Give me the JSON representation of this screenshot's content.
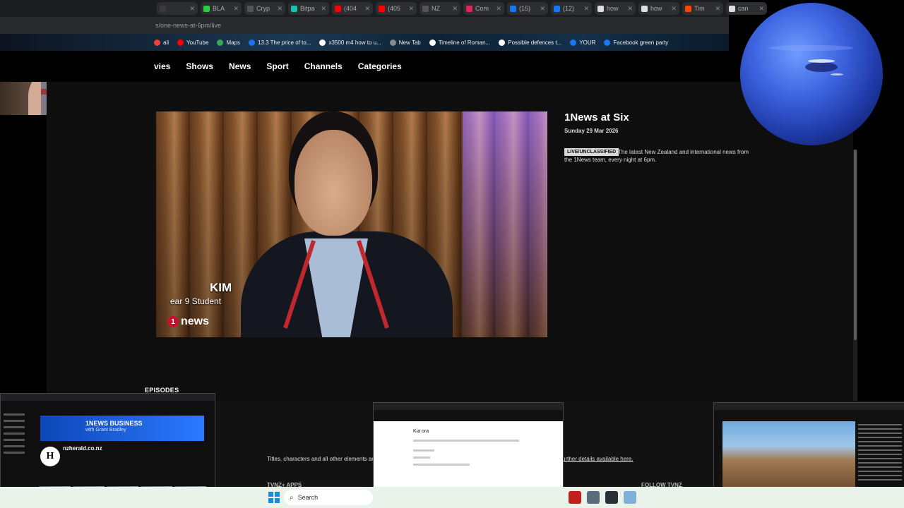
{
  "browser": {
    "tabs": [
      {
        "label": "",
        "color": "#3b3b3b"
      },
      {
        "label": "BLA",
        "color": "#2ecc40"
      },
      {
        "label": "Cryp",
        "color": "#555555"
      },
      {
        "label": "Bitpa",
        "color": "#19c1b0"
      },
      {
        "label": "(404",
        "color": "#ff0000"
      },
      {
        "label": "(405",
        "color": "#ff0000"
      },
      {
        "label": "NZ",
        "color": "#555555"
      },
      {
        "label": "Com",
        "color": "#e0245e"
      },
      {
        "label": "(15)",
        "color": "#1877f2"
      },
      {
        "label": "(12)",
        "color": "#1877f2"
      },
      {
        "label": "how",
        "color": "#dddddd"
      },
      {
        "label": "how",
        "color": "#dddddd"
      },
      {
        "label": "Tim",
        "color": "#ff4500"
      },
      {
        "label": "can",
        "color": "#dddddd"
      }
    ],
    "url": "s/one-news-at-6pm/live",
    "bookmarks": [
      {
        "label": "ail",
        "color": "#ea4335"
      },
      {
        "label": "YouTube",
        "color": "#ff0000"
      },
      {
        "label": "Maps",
        "color": "#34a853"
      },
      {
        "label": "13.3 The price of to...",
        "color": "#1a73e8"
      },
      {
        "label": "x3500 m4 how to u...",
        "color": "#ffffff"
      },
      {
        "label": "New Tab",
        "color": "#888888"
      },
      {
        "label": "Timeline of Roman...",
        "color": "#ffffff"
      },
      {
        "label": "Possible defences t...",
        "color": "#ffffff"
      },
      {
        "label": "YOUR",
        "color": "#1877f2"
      },
      {
        "label": "Facebook green party",
        "color": "#1877f2"
      }
    ]
  },
  "nav": {
    "items": [
      "vies",
      "Shows",
      "News",
      "Sport",
      "Channels",
      "Categories"
    ]
  },
  "video": {
    "lower_third_name": "KIM",
    "lower_third_role": "ear 9 Student",
    "logo_number": "1",
    "logo_text": "news"
  },
  "show": {
    "title": "1News at Six",
    "date": "Sunday 29 Mar 2026",
    "badge": "LIVE/UNCLASSIFIED",
    "description": "The latest New Zealand and international news from the 1News team, every night at 6pm."
  },
  "episodes_label": "EPISODES",
  "footer": {
    "disclaimer_left": "Titles, characters and all other elements are",
    "disclaimer_link": "urther details available here.",
    "apps_heading": "TVNZ+ APPS",
    "follow_heading": "FOLLOW TVNZ"
  },
  "taskbar": {
    "search_placeholder": "Search"
  },
  "previews": {
    "youtube": {
      "banner_title": "1NEWS BUSINESS",
      "banner_sub": "with Grant Bradley",
      "channel_name": "nzherald.co.nz",
      "avatar_letter": "H"
    },
    "kia": {
      "heading": "Kia ora"
    }
  }
}
